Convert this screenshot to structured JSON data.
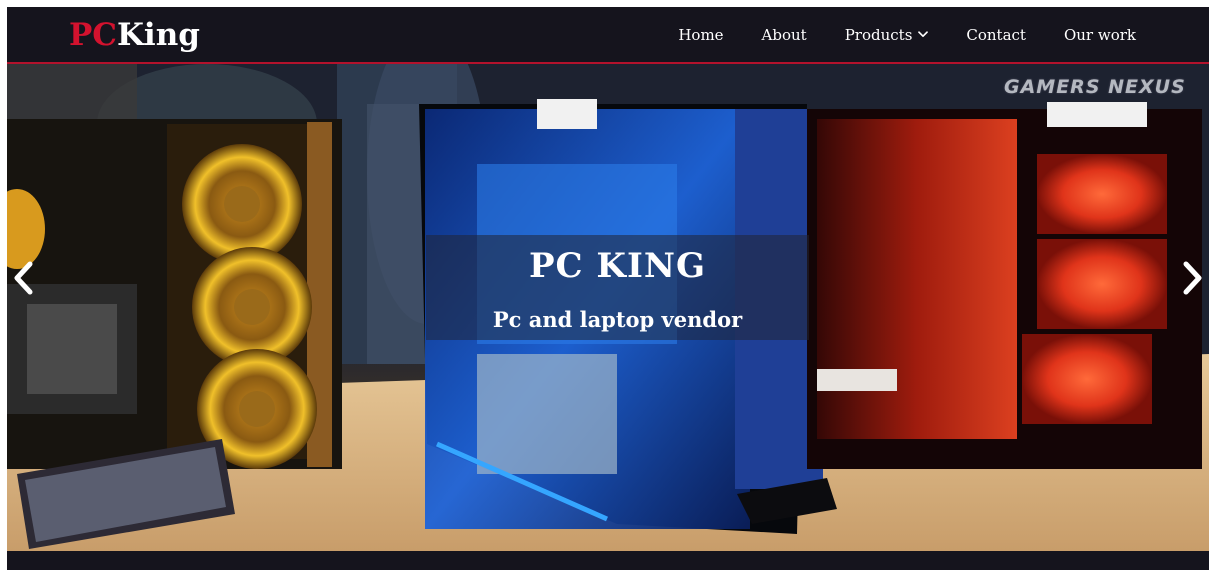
{
  "brand": {
    "part1": "PC",
    "part2": "King"
  },
  "nav": {
    "items": [
      {
        "label": "Home"
      },
      {
        "label": "About"
      },
      {
        "label": "Products"
      },
      {
        "label": "Contact"
      },
      {
        "label": "Our work"
      }
    ],
    "products_icon": "chevron-down-icon"
  },
  "hero": {
    "title": "PC KING",
    "subtitle": "Pc and laptop vendor",
    "watermark": "GAMERS NEXUS",
    "prev_icon": "chevron-left-icon",
    "next_icon": "chevron-right-icon"
  },
  "colors": {
    "navbar_bg": "#15141d",
    "brand_red": "#d3122e",
    "accent_line": "#b3122c",
    "text": "#ffffff"
  }
}
